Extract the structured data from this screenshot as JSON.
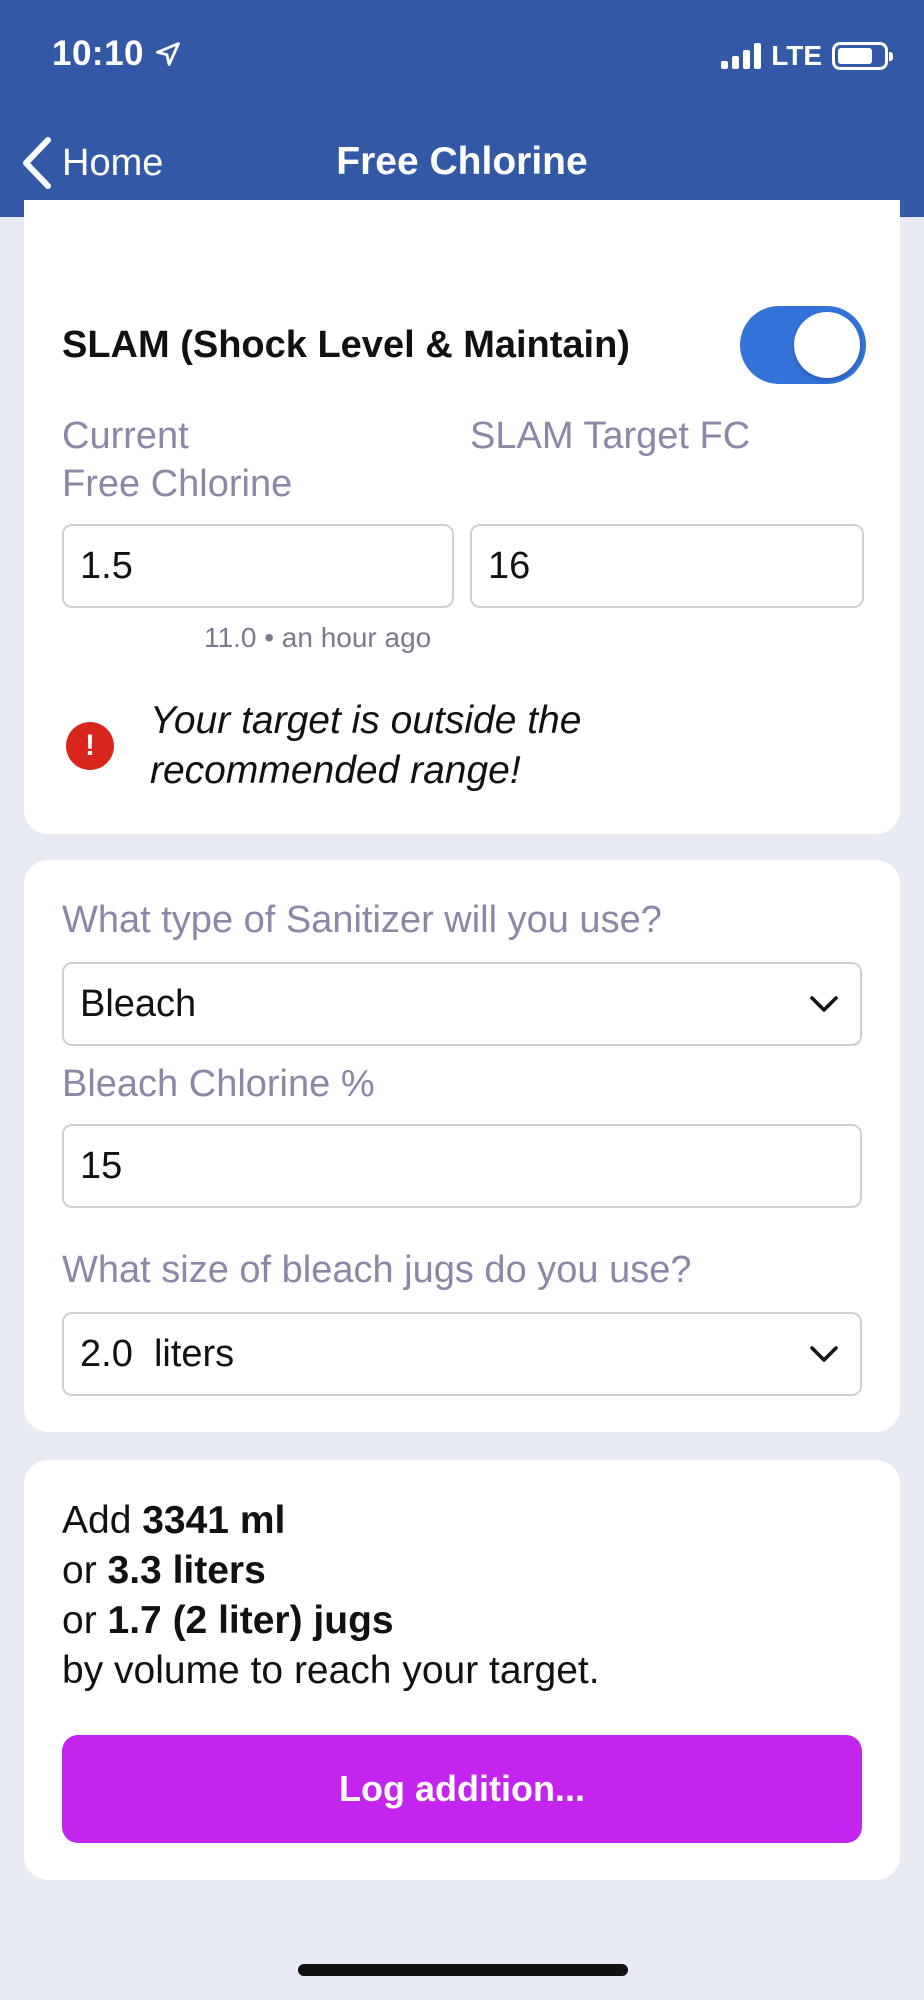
{
  "status": {
    "time": "10:10",
    "network": "LTE"
  },
  "nav": {
    "back_label": "Home",
    "title": "Free Chlorine"
  },
  "slam": {
    "title": "SLAM (Shock Level & Maintain)",
    "enabled": true,
    "current_label_line1": "Current",
    "current_label_line2": "Free Chlorine",
    "target_label": "SLAM Target FC",
    "current_value": "1.5",
    "target_value": "16",
    "last_reading": "11.0 • an hour ago",
    "warning_line1": "Your target is outside the",
    "warning_line2": "recommended range!"
  },
  "sanitizer": {
    "type_label": "What type of Sanitizer will you use?",
    "type_value": "Bleach",
    "percent_label": "Bleach Chlorine %",
    "percent_value": "15",
    "jug_label": "What size of bleach jugs do you use?",
    "jug_value": "2.0  liters"
  },
  "result": {
    "line1_prefix": "Add ",
    "line1_value": "3341 ml",
    "line2_prefix": "or ",
    "line2_value": "3.3 liters",
    "line3_prefix": "or ",
    "line3_value": "1.7 (2 liter) jugs",
    "line4": "by volume to reach your target.",
    "button_label": "Log addition..."
  },
  "colors": {
    "header": "#3358a6",
    "toggle_on": "#3272d9",
    "warning": "#d8261c",
    "button": "#c325ee",
    "background": "#e9ebf4"
  }
}
